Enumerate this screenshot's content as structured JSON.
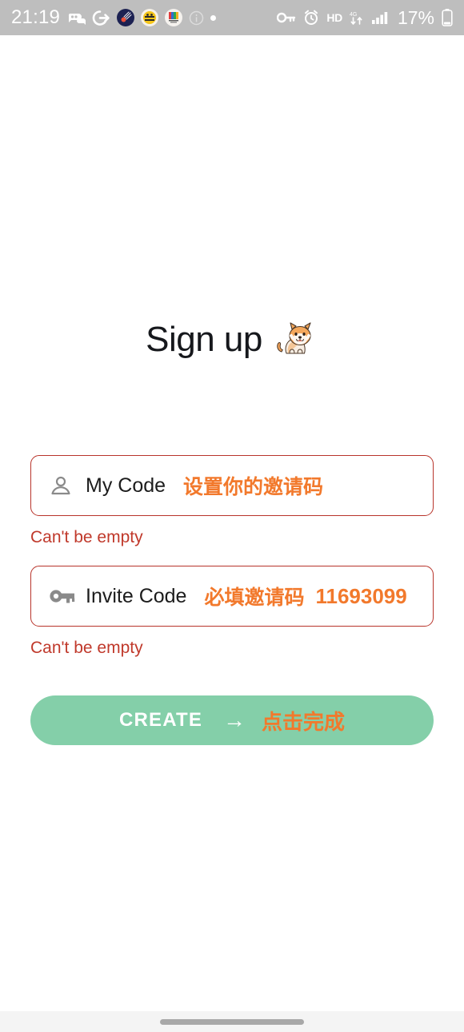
{
  "status_bar": {
    "time": "21:19",
    "battery_percent": "17%",
    "hd_label": "HD",
    "left_icons": [
      {
        "name": "game-controller-chat-icon",
        "glyph": "🎮"
      },
      {
        "name": "google-arrow-icon",
        "glyph": "G"
      },
      {
        "name": "app-badge-comet-icon",
        "glyph": "☄"
      },
      {
        "name": "app-badge-face-icon",
        "glyph": "🐝"
      },
      {
        "name": "app-badge-m-logo-icon",
        "glyph": "M"
      },
      {
        "name": "info-circle-icon",
        "glyph": "ⓘ"
      },
      {
        "name": "dot-indicator-icon",
        "glyph": "•"
      }
    ],
    "right_icons": [
      {
        "name": "vpn-key-icon",
        "glyph": "⚷"
      },
      {
        "name": "alarm-clock-icon",
        "glyph": "⏰"
      },
      {
        "name": "hd-icon",
        "glyph": "HD"
      },
      {
        "name": "data-transfer-icon",
        "glyph": "⇅"
      },
      {
        "name": "signal-bars-icon",
        "glyph": "▂▄▆"
      },
      {
        "name": "battery-icon",
        "glyph": "▯"
      }
    ],
    "colors": {
      "background": "#bebebe",
      "foreground": "#ffffff"
    }
  },
  "page": {
    "title": "Sign up",
    "title_emoji_name": "shiba-inu-dog-emoji"
  },
  "form": {
    "fields": [
      {
        "id": "mycode",
        "icon": "person-outline-icon",
        "label": "My Code",
        "value": "",
        "hint_cn": "设置你的邀请码",
        "hint_number": "",
        "error": "Can't be empty"
      },
      {
        "id": "invite",
        "icon": "vpn-key-icon",
        "label": "Invite Code",
        "value": "",
        "hint_cn": "必填邀请码",
        "hint_number": "11693099",
        "error": "Can't be empty"
      }
    ],
    "submit": {
      "label": "CREATE",
      "arrow": "→",
      "annotation_cn": "点击完成"
    },
    "colors": {
      "field_border": "#b8342b",
      "error_text": "#c0392b",
      "annotation_orange": "#f2792c",
      "button_green": "#84cfa9",
      "label_text": "#1c1c1c",
      "icon_gray": "#8a8a8a"
    }
  },
  "navigation": {
    "home_indicator_name": "home-gesture-indicator"
  }
}
